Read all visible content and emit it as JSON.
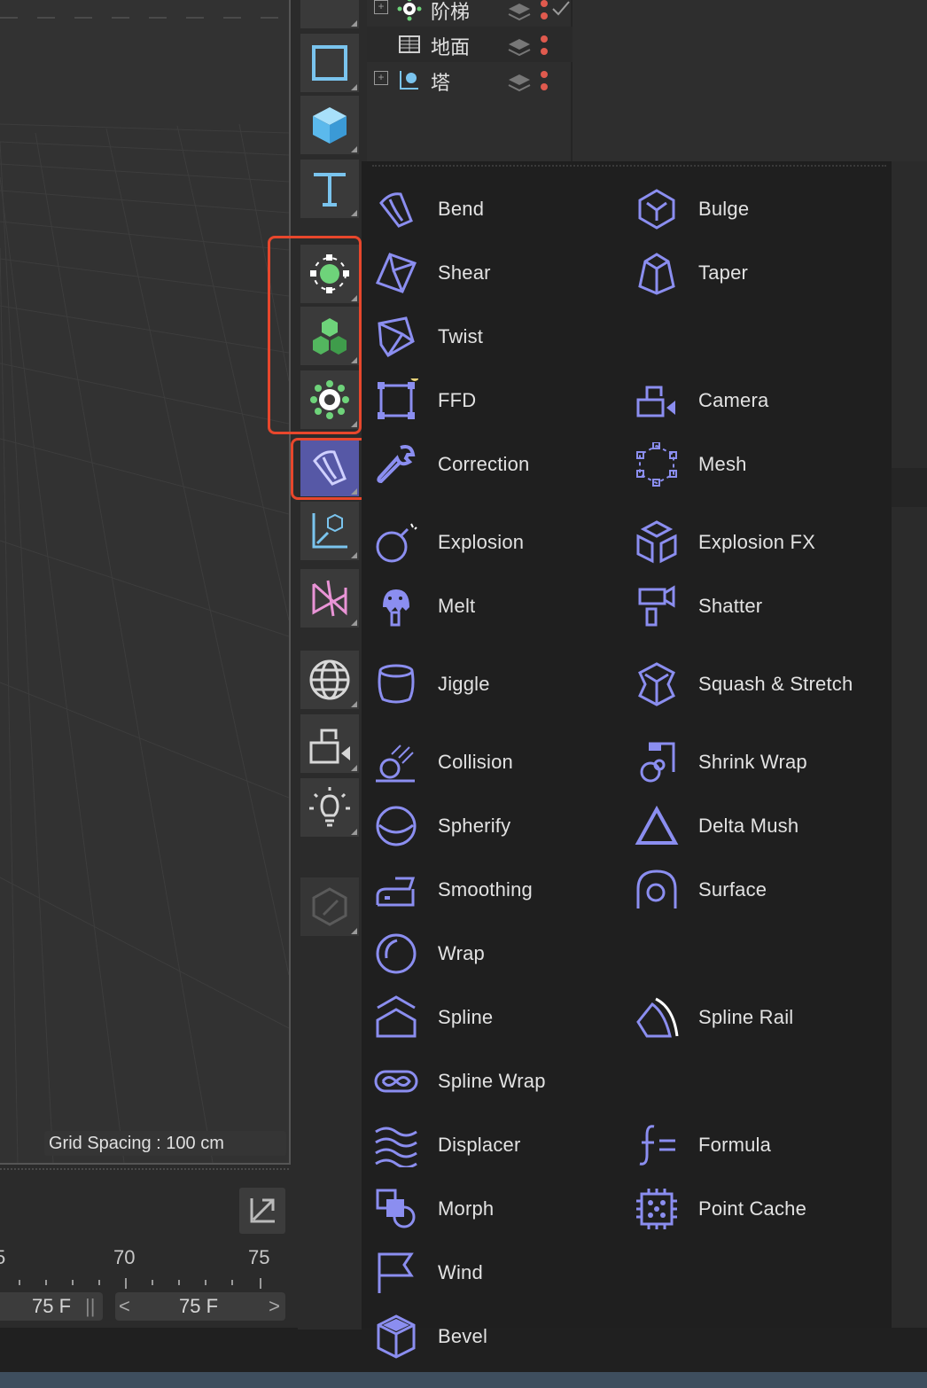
{
  "viewport": {
    "grid_spacing": "Grid Spacing : 100 cm"
  },
  "timeline": {
    "tick_labels": [
      "5",
      "70",
      "75"
    ],
    "frame_current": "75 F",
    "frame_end": "75 F",
    "frame_sep": "||",
    "prev_glyph": "<",
    "next_glyph": ">"
  },
  "object_manager": {
    "rows": [
      {
        "label": "阶梯",
        "icon": "cloner-gear-icon",
        "expandable": true
      },
      {
        "label": "地面",
        "icon": "floor-icon",
        "expandable": false
      },
      {
        "label": "塔",
        "icon": "null-object-icon",
        "expandable": true
      }
    ],
    "colors": {
      "dot_red": "#e05a4e",
      "check": "#9a9a9a"
    }
  },
  "toolbar": {
    "buttons": [
      {
        "name": "spline-rectangle-tool",
        "icon": "rectangle-icon"
      },
      {
        "name": "cube-tool",
        "icon": "cube-icon"
      },
      {
        "name": "text-tool",
        "icon": "text-icon"
      },
      {
        "name": "generator-tool",
        "icon": "generator-dot-icon"
      },
      {
        "name": "mograph-tool",
        "icon": "mograph-cubes-icon"
      },
      {
        "name": "cloner-tool",
        "icon": "gear-generator-icon"
      },
      {
        "name": "deformer-tool",
        "icon": "bend-deformer-icon",
        "active": true
      },
      {
        "name": "field-tool",
        "icon": "field-axis-icon"
      },
      {
        "name": "volume-tool",
        "icon": "volume-icon"
      },
      {
        "name": "environment-tool",
        "icon": "globe-icon"
      },
      {
        "name": "camera-tool",
        "icon": "camera-icon"
      },
      {
        "name": "light-tool",
        "icon": "light-bulb-icon"
      },
      {
        "name": "tag-tool",
        "icon": "edit-pencil-icon",
        "disabled": true
      }
    ],
    "accent": "#5658a6",
    "highlight": "#e8472c"
  },
  "deformer_menu": {
    "icon_color": "#8b8ef0",
    "items": [
      {
        "label": "Bend",
        "icon": "bend-icon"
      },
      {
        "label": "Bulge",
        "icon": "bulge-icon"
      },
      {
        "label": "Shear",
        "icon": "shear-icon"
      },
      {
        "label": "Taper",
        "icon": "taper-icon"
      },
      {
        "label": "Twist",
        "icon": "twist-icon"
      },
      {
        "label": "FFD",
        "icon": "ffd-icon"
      },
      {
        "label": "Camera",
        "icon": "camera-icon"
      },
      {
        "label": "Correction",
        "icon": "wrench-icon"
      },
      {
        "label": "Mesh",
        "icon": "mesh-icon"
      },
      {
        "label": "Explosion",
        "icon": "bomb-icon"
      },
      {
        "label": "Explosion FX",
        "icon": "explosion-fx-icon"
      },
      {
        "label": "Melt",
        "icon": "melt-icon"
      },
      {
        "label": "Shatter",
        "icon": "hammer-icon"
      },
      {
        "label": "Jiggle",
        "icon": "jiggle-icon"
      },
      {
        "label": "Squash & Stretch",
        "icon": "squash-stretch-icon"
      },
      {
        "label": "Collision",
        "icon": "collision-icon"
      },
      {
        "label": "Shrink Wrap",
        "icon": "shrink-wrap-icon"
      },
      {
        "label": "Spherify",
        "icon": "spherify-icon"
      },
      {
        "label": "Delta Mush",
        "icon": "triangle-icon"
      },
      {
        "label": "Smoothing",
        "icon": "iron-icon"
      },
      {
        "label": "Surface",
        "icon": "surface-icon"
      },
      {
        "label": "Wrap",
        "icon": "wrap-circle-icon"
      },
      {
        "label": "Spline",
        "icon": "spline-house-icon"
      },
      {
        "label": "Spline Rail",
        "icon": "spline-rail-icon"
      },
      {
        "label": "Spline Wrap",
        "icon": "infinity-icon"
      },
      {
        "label": "Displacer",
        "icon": "waves-icon"
      },
      {
        "label": "Formula",
        "icon": "formula-icon"
      },
      {
        "label": "Morph",
        "icon": "morph-icon"
      },
      {
        "label": "Point Cache",
        "icon": "chip-icon"
      },
      {
        "label": "Wind",
        "icon": "flag-icon"
      },
      {
        "label": "Bevel",
        "icon": "bevel-cube-icon"
      }
    ]
  }
}
